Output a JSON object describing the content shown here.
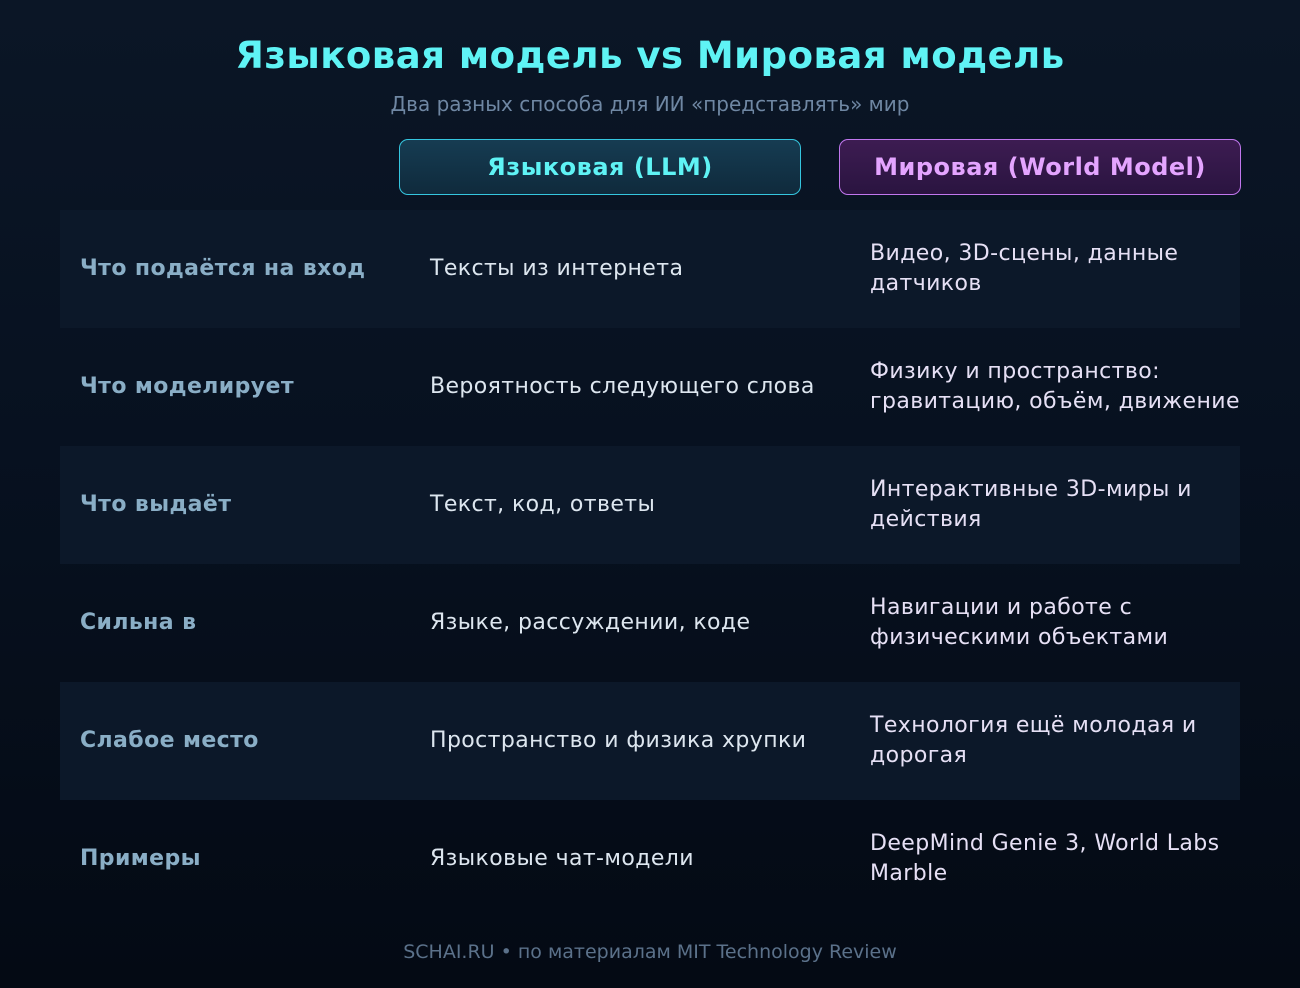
{
  "title": "Языковая модель vs Мировая модель",
  "subtitle": "Два разных способа для ИИ «представлять» мир",
  "columns": {
    "llm": "Языковая (LLM)",
    "world": "Мировая (World Model)"
  },
  "rows": [
    {
      "label": "Что подаётся на вход",
      "llm": "Тексты из интернета",
      "world": "Видео, 3D-сцены, данные датчиков"
    },
    {
      "label": "Что моделирует",
      "llm": "Вероятность следующего слова",
      "world": "Физику и пространство: гравитацию, объём, движение"
    },
    {
      "label": "Что выдаёт",
      "llm": "Текст, код, ответы",
      "world": "Интерактивные 3D-миры и действия"
    },
    {
      "label": "Сильна в",
      "llm": "Языке, рассуждении, коде",
      "world": "Навигации и работе с физическими объектами"
    },
    {
      "label": "Слабое место",
      "llm": "Пространство и физика хрупки",
      "world": "Технология ещё молодая и дорогая"
    },
    {
      "label": "Примеры",
      "llm": "Языковые чат-модели",
      "world": "DeepMind Genie 3, World Labs Marble"
    }
  ],
  "footer": "SCHAI.RU • по материалам MIT Technology Review",
  "colors": {
    "title": "#5ff3f5",
    "llm_accent": "#35c6df",
    "world_accent": "#c177ee",
    "row_label": "#8aaec6"
  }
}
